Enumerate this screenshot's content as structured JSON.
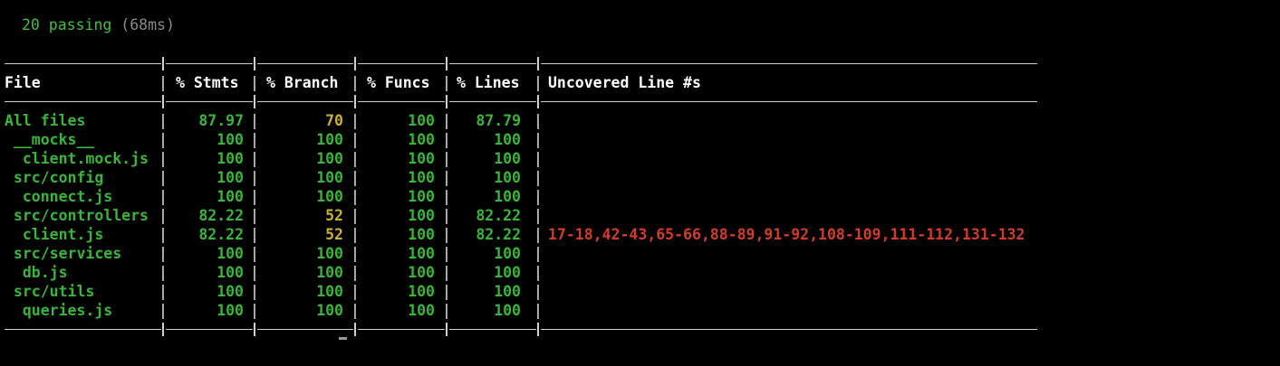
{
  "summary": {
    "passing": "20 passing",
    "duration": "(68ms)"
  },
  "table": {
    "headers": {
      "file": "File",
      "stmts": "% Stmts",
      "branch": "% Branch",
      "funcs": "% Funcs",
      "lines": "% Lines",
      "uncovered": "Uncovered Line #s"
    },
    "rows": [
      {
        "file": "All files",
        "stmts": "87.97",
        "branch": "70",
        "funcs": "100",
        "lines": "87.79",
        "uncovered": "",
        "branch_color": "yellow",
        "stmts_color": "green",
        "lines_color": "green"
      },
      {
        "file": " __mocks__",
        "stmts": "100",
        "branch": "100",
        "funcs": "100",
        "lines": "100",
        "uncovered": "",
        "branch_color": "green",
        "stmts_color": "green",
        "lines_color": "green"
      },
      {
        "file": "  client.mock.js",
        "stmts": "100",
        "branch": "100",
        "funcs": "100",
        "lines": "100",
        "uncovered": "",
        "branch_color": "green",
        "stmts_color": "green",
        "lines_color": "green"
      },
      {
        "file": " src/config",
        "stmts": "100",
        "branch": "100",
        "funcs": "100",
        "lines": "100",
        "uncovered": "",
        "branch_color": "green",
        "stmts_color": "green",
        "lines_color": "green"
      },
      {
        "file": "  connect.js",
        "stmts": "100",
        "branch": "100",
        "funcs": "100",
        "lines": "100",
        "uncovered": "",
        "branch_color": "green",
        "stmts_color": "green",
        "lines_color": "green"
      },
      {
        "file": " src/controllers",
        "stmts": "82.22",
        "branch": "52",
        "funcs": "100",
        "lines": "82.22",
        "uncovered": "",
        "branch_color": "yellow",
        "stmts_color": "green",
        "lines_color": "green"
      },
      {
        "file": "  client.js",
        "stmts": "82.22",
        "branch": "52",
        "funcs": "100",
        "lines": "82.22",
        "uncovered": "17-18,42-43,65-66,88-89,91-92,108-109,111-112,131-132",
        "branch_color": "yellow",
        "stmts_color": "green",
        "lines_color": "green"
      },
      {
        "file": " src/services",
        "stmts": "100",
        "branch": "100",
        "funcs": "100",
        "lines": "100",
        "uncovered": "",
        "branch_color": "green",
        "stmts_color": "green",
        "lines_color": "green"
      },
      {
        "file": "  db.js",
        "stmts": "100",
        "branch": "100",
        "funcs": "100",
        "lines": "100",
        "uncovered": "",
        "branch_color": "green",
        "stmts_color": "green",
        "lines_color": "green"
      },
      {
        "file": " src/utils",
        "stmts": "100",
        "branch": "100",
        "funcs": "100",
        "lines": "100",
        "uncovered": "",
        "branch_color": "green",
        "stmts_color": "green",
        "lines_color": "green"
      },
      {
        "file": "  queries.js",
        "stmts": "100",
        "branch": "100",
        "funcs": "100",
        "lines": "100",
        "uncovered": "",
        "branch_color": "green",
        "stmts_color": "green",
        "lines_color": "green"
      }
    ]
  },
  "colors": {
    "background": "#000000",
    "pass": "#39b539",
    "warn": "#c9b133",
    "uncovered": "#d33b2b",
    "muted": "#8a8a8a"
  }
}
